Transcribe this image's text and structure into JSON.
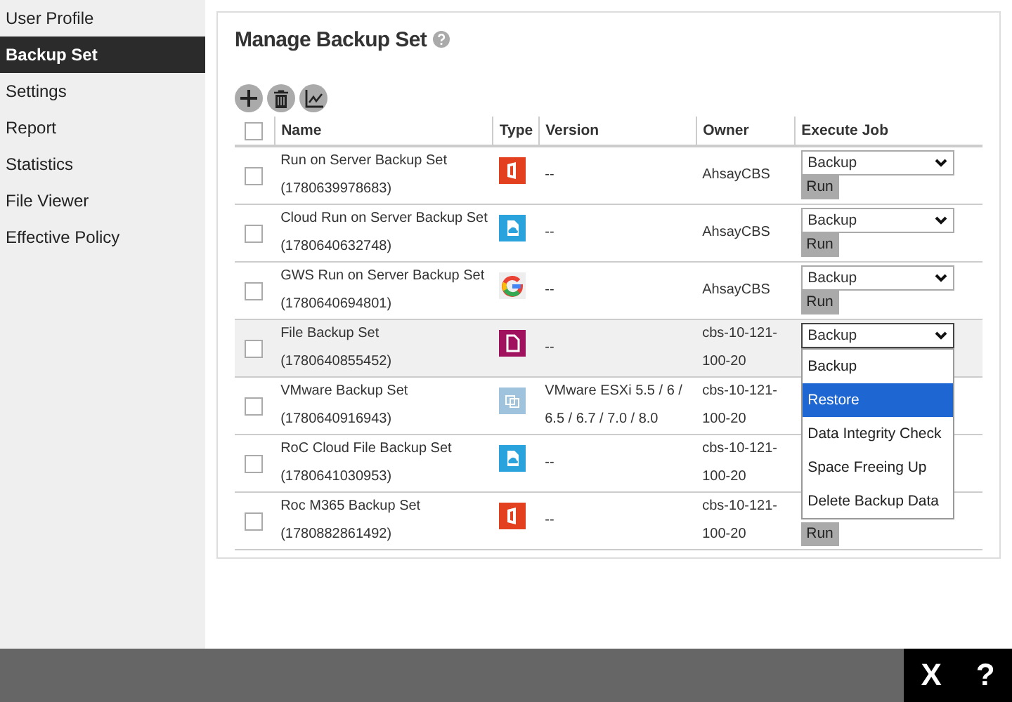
{
  "sidebar": {
    "items": [
      {
        "label": "User Profile",
        "selected": false
      },
      {
        "label": "Backup Set",
        "selected": true
      },
      {
        "label": "Settings",
        "selected": false
      },
      {
        "label": "Report",
        "selected": false
      },
      {
        "label": "Statistics",
        "selected": false
      },
      {
        "label": "File Viewer",
        "selected": false
      },
      {
        "label": "Effective Policy",
        "selected": false
      }
    ]
  },
  "panel": {
    "title": "Manage Backup Set"
  },
  "table": {
    "select_all_checked": false,
    "columns": [
      "Name",
      "Type",
      "Version",
      "Owner",
      "Execute Job"
    ],
    "rows": [
      {
        "name": "Run on Server Backup Set",
        "id": "(1780639978683)",
        "kind": "office",
        "version": "--",
        "owner": "AhsayCBS",
        "checked": false,
        "highlighted": false,
        "job": {
          "select": "Backup",
          "run": "Run"
        }
      },
      {
        "name": "Cloud Run on Server Backup Set",
        "id": "(1780640632748)",
        "kind": "cloud",
        "version": "--",
        "owner": "AhsayCBS",
        "checked": false,
        "highlighted": false,
        "job": {
          "select": "Backup",
          "run": "Run"
        }
      },
      {
        "name": "GWS Run on Server Backup Set",
        "id": "(1780640694801)",
        "kind": "google",
        "version": "--",
        "owner": "AhsayCBS",
        "checked": false,
        "highlighted": false,
        "job": {
          "select": "Backup",
          "run": "Run"
        }
      },
      {
        "name": "File Backup Set",
        "id": "(1780640855452)",
        "kind": "file",
        "version": "--",
        "owner": "cbs-10-121-100-20",
        "checked": false,
        "highlighted": true,
        "job": {
          "select": "Backup",
          "open": true,
          "options": [
            {
              "label": "Backup",
              "selected": false
            },
            {
              "label": "Restore",
              "selected": true
            },
            {
              "label": "Data Integrity Check",
              "selected": false
            },
            {
              "label": "Space Freeing Up",
              "selected": false
            },
            {
              "label": "Delete Backup Data",
              "selected": false
            }
          ]
        }
      },
      {
        "name": "VMware Backup Set",
        "id": "(1780640916943)",
        "kind": "vmware",
        "version": "VMware ESXi 5.5 / 6 / 6.5 / 6.7 / 7.0 / 8.0",
        "owner": "cbs-10-121-100-20",
        "checked": false,
        "highlighted": false,
        "job": {}
      },
      {
        "name": "RoC Cloud File Backup Set",
        "id": "(1780641030953)",
        "kind": "cloud",
        "version": "--",
        "owner": "cbs-10-121-100-20",
        "checked": false,
        "highlighted": false,
        "job": {}
      },
      {
        "name": "Roc M365 Backup Set",
        "id": "(1780882861492)",
        "kind": "office",
        "version": "--",
        "owner": "cbs-10-121-100-20",
        "checked": false,
        "highlighted": false,
        "job": {
          "run": "Run"
        }
      }
    ]
  },
  "footer": {
    "close": "X",
    "help": "?"
  }
}
